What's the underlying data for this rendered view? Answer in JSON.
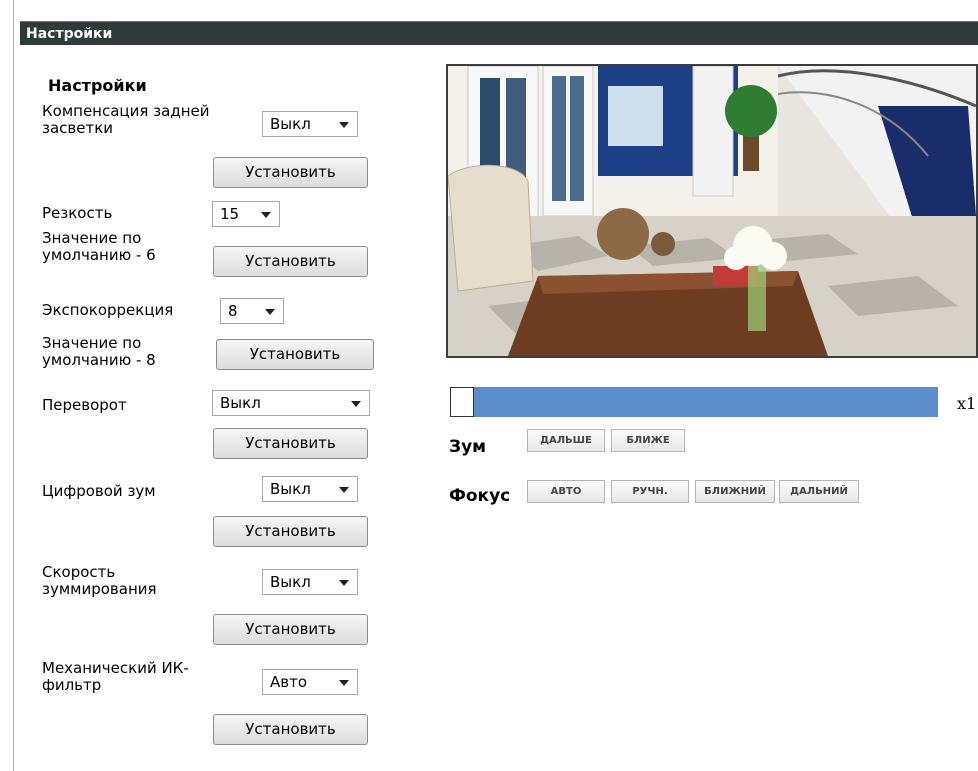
{
  "window": {
    "title": "Настройки"
  },
  "settings": {
    "heading": "Настройки",
    "backlight": {
      "label": "Компенсация задней засветки",
      "value": "Выкл",
      "button": "Установить"
    },
    "sharpness": {
      "label": "Резкость",
      "value": "15",
      "default_note": "Значение по умолчанию - 6",
      "button": "Установить"
    },
    "exposure": {
      "label": "Экспокоррекция",
      "value": "8",
      "default_note": "Значение по умолчанию - 8",
      "button": "Установить"
    },
    "flip": {
      "label": "Переворот",
      "value": "Выкл",
      "button": "Установить"
    },
    "digital_zoom": {
      "label": "Цифровой зум",
      "value": "Выкл",
      "button": "Установить"
    },
    "zoom_speed": {
      "label": "Скорость зуммирования",
      "value": "Выкл",
      "button": "Установить"
    },
    "ir_filter": {
      "label": "Механический ИК-фильтр",
      "value": "Авто",
      "button": "Установить"
    }
  },
  "preview": {
    "zoom_level": "x1",
    "zoom_fraction": 0.0,
    "zoom": {
      "label": "Зум",
      "far": "ДАЛЬШЕ",
      "near": "БЛИЖЕ"
    },
    "focus": {
      "label": "Фокус",
      "auto": "АВТО",
      "manual": "РУЧН.",
      "near": "БЛИЖНИЙ",
      "far": "ДАЛЬНИЙ"
    }
  },
  "colors": {
    "titlebar": "#2f3a3a",
    "zoombar": "#5b8dcd"
  }
}
